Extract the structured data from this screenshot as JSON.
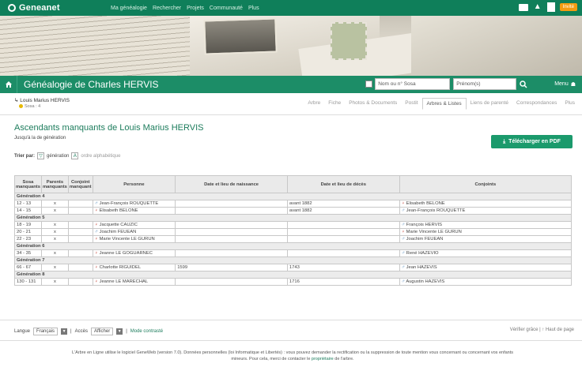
{
  "header": {
    "logo": "Geneanet",
    "nav": [
      "Ma généalogie",
      "Rechercher",
      "Projets",
      "Communauté",
      "Plus"
    ],
    "premium_button": "Invité"
  },
  "genealogy_bar": {
    "title": "Généalogie de Charles HERVIS",
    "search_nom": "Nom ou n° Sosa",
    "search_prenom": "Prénom(s)",
    "menu_label": "Menu"
  },
  "person_header": {
    "breadcrumb": "Louis Marius HERVIS",
    "sosa": "Sosa : 4",
    "tabs": [
      "Arbre",
      "Fiche",
      "Photos & Documents",
      "Postit",
      "Arbres & Listes",
      "Liens de parenté",
      "Correspondances",
      "Plus"
    ],
    "active_tab": "Arbres & Listes"
  },
  "content": {
    "title": "Ascendants manquants de Louis Marius HERVIS",
    "subtitle": "Jusqu'à la de génération",
    "download_label": "Télécharger en PDF",
    "sort_label": "Trier par:",
    "sort_generation": "génération",
    "sort_alpha": "ordre alphabétique"
  },
  "table": {
    "headers": [
      "Sosa manquants",
      "Parents manquants",
      "Conjoint manquant",
      "Personne",
      "Date et lieu de naissance",
      "Date et lieu de décès",
      "Conjoints"
    ],
    "rows": [
      {
        "type": "gen",
        "label": "Génération 4"
      },
      {
        "type": "row",
        "sosa": "12 - 13",
        "parents": "x",
        "conjoint": "",
        "sex": "m",
        "person": "Jean-François ROUQUETTE",
        "birth": "",
        "death": "avant 1882",
        "csex": "f",
        "spouse": "Elisabeth BELONE"
      },
      {
        "type": "row",
        "sosa": "14 - 15",
        "parents": "x",
        "conjoint": "",
        "sex": "f",
        "person": "Elisabeth BELONE",
        "birth": "",
        "death": "avant 1882",
        "csex": "m",
        "spouse": "Jean-François ROUQUETTE"
      },
      {
        "type": "gen",
        "label": "Génération 5"
      },
      {
        "type": "row",
        "sosa": "18 - 19",
        "parents": "x",
        "conjoint": "",
        "sex": "f",
        "person": "Jacquette CAUZIC",
        "birth": "",
        "death": "",
        "csex": "m",
        "spouse": "François HERVIS"
      },
      {
        "type": "row",
        "sosa": "20 - 21",
        "parents": "x",
        "conjoint": "",
        "sex": "m",
        "person": "Joachim FEUEAN",
        "birth": "",
        "death": "",
        "csex": "f",
        "spouse": "Marie Vincente LE GURUN"
      },
      {
        "type": "row",
        "sosa": "22 - 23",
        "parents": "x",
        "conjoint": "",
        "sex": "f",
        "person": "Marie Vincente LE GURUN",
        "birth": "",
        "death": "",
        "csex": "m",
        "spouse": "Joachim FEUEAN"
      },
      {
        "type": "gen",
        "label": "Génération 6"
      },
      {
        "type": "row",
        "sosa": "34 - 35",
        "parents": "x",
        "conjoint": "",
        "sex": "f",
        "person": "Jeanne LE GOGUARNEC",
        "birth": "",
        "death": "",
        "csex": "m",
        "spouse": "René HAZEVIO"
      },
      {
        "type": "gen",
        "label": "Génération 7"
      },
      {
        "type": "row",
        "sosa": "66 - 67",
        "parents": "x",
        "conjoint": "",
        "sex": "f",
        "person": "Charlotte RIGUIDEL",
        "birth": "1599",
        "death": "1743",
        "csex": "m",
        "spouse": "Jean HAZEVIS"
      },
      {
        "type": "gen",
        "label": "Génération 8"
      },
      {
        "type": "row",
        "sosa": "130 - 131",
        "parents": "x",
        "conjoint": "",
        "sex": "f",
        "person": "Jeanne LE MARECHAL",
        "birth": "",
        "death": "1716",
        "csex": "m",
        "spouse": "Augustin HAZEVIS"
      }
    ]
  },
  "footer": {
    "langue_label": "Langue",
    "langue_value": "Français",
    "acces_label": "Accès",
    "acces_value": "Afficher",
    "mode_label": "Mode contrasté",
    "right_links": "Vérifier grâce | ↑ Haut de page",
    "legal_1": "L'Arbre en Ligne utilise le logiciel GeneWeb (version 7.0). Données personnelles (loi Informatique et Libertés) : vous pouvez demander la rectification ou la suppression de toute mention vous concernant ou concernant vos enfants",
    "legal_2": "mineurs. Pour cela, merci de contacter le",
    "legal_link": "propriétaire",
    "legal_3": "de l'arbre."
  }
}
